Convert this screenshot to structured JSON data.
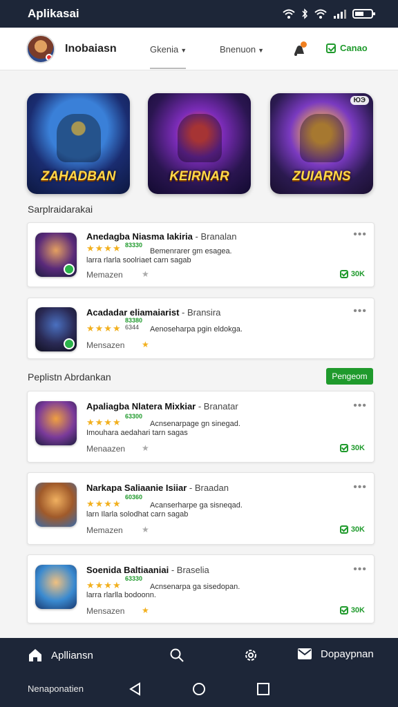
{
  "status_bar": {
    "app_name": "Aplikasai"
  },
  "header": {
    "title": "Inobaiasn",
    "menu_1": "Gkenia",
    "menu_2": "Bnenuon",
    "cta": "Canao"
  },
  "banners": [
    {
      "title": "ZAHADBAN"
    },
    {
      "title": "KEIRNAR"
    },
    {
      "title": "ZUIARNS",
      "badge": "ЮЭ"
    }
  ],
  "section_1": {
    "title": "Sarplraidarakai"
  },
  "section_2": {
    "title": "Peplistn Abrdankan",
    "button": "Pengeom"
  },
  "cards": [
    {
      "title": "Anedagba Niasma Iakiria",
      "title_sub": "- Branalan",
      "stars": "★★★★",
      "tag": "83330",
      "desc": "Bemenrarer gm esagea.",
      "desc2": "larra rlarla soolriaet carn sagab",
      "meta": "Memazen",
      "action": "30K"
    },
    {
      "title": "Acadadar eliamaiarist",
      "title_sub": "- Bransira",
      "stars": "★★★★",
      "tag": "83380",
      "tag2": "6344",
      "desc": "Aenoseharpa pgin eldokga.",
      "desc2": "",
      "meta": "Mensazen",
      "action": ""
    },
    {
      "title": "Apaliagba Nlatera Mixkiar",
      "title_sub": "- Branatar",
      "stars": "★★★★",
      "tag": "63300",
      "desc": "Acnsenarpage gn sinegad.",
      "desc2": "Imouhara aedahari tarn sagas",
      "meta": "Menaazen",
      "action": "30K"
    },
    {
      "title": "Narkapa Saliaanie Isiiar",
      "title_sub": "- Braadan",
      "stars": "★★★★",
      "tag": "60360",
      "desc": "Acanserharpe ga sisneqad.",
      "desc2": "larn Ilarla solodhat carn sagab",
      "meta": "Memazen",
      "action": "30K"
    },
    {
      "title": "Soenida Baltiaaniai",
      "title_sub": "- Braselia",
      "stars": "★★★★",
      "tag": "63330",
      "desc": "Acnsenarpa ga sisedopan.",
      "desc2": "larra rlarlla bodoonn.",
      "meta": "Mensazen",
      "action": "30K"
    }
  ],
  "bottom_nav": {
    "home": "Aplliansn",
    "mail": "Dopaypnan",
    "system_label": "Nenaponatien"
  },
  "icons": {
    "status": [
      "wifi-icon",
      "signal-icon",
      "battery-icon"
    ],
    "nav": [
      "home-icon",
      "search-icon",
      "settings-icon",
      "mail-icon"
    ],
    "system": [
      "back-icon",
      "home-circle-icon",
      "recent-square-icon"
    ]
  },
  "colors": {
    "accent": "#1f9a2c",
    "nav_bg": "#1d2638",
    "star": "#f2b01e"
  }
}
